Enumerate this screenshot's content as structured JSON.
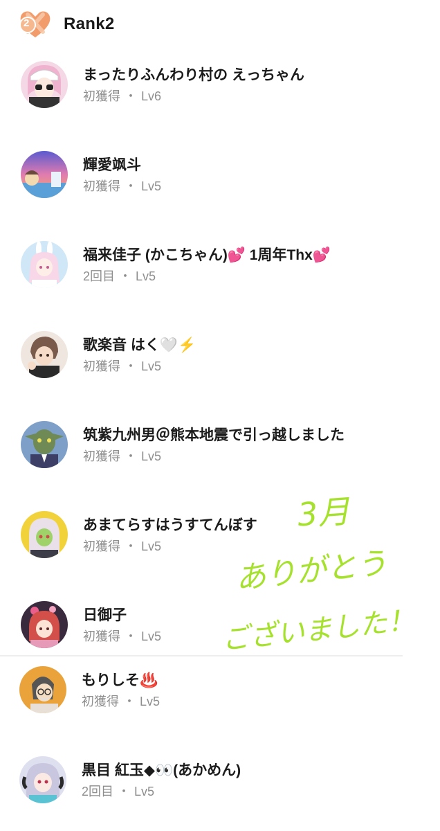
{
  "header": {
    "rank_number": "2",
    "title": "Rank2",
    "badge_color": "#f29b6b"
  },
  "rows": [
    {
      "name": "まったりふんわり村の えっちゃん",
      "label": "初獲得",
      "level": "Lv6",
      "avatar_bg": "#f4d8e6",
      "avatar_fg": "#f0b3cf"
    },
    {
      "name": "輝愛飒斗",
      "label": "初獲得",
      "level": "Lv5",
      "avatar_bg": "#7c6fd1",
      "avatar_fg": "#f2a05f"
    },
    {
      "name": "福来佳子 (かこちゃん)💕 1周年Thx💕",
      "label": "2回目",
      "level": "Lv5",
      "avatar_bg": "#cfe7f7",
      "avatar_fg": "#f7d7e8"
    },
    {
      "name": "歌楽音 はく🤍⚡️",
      "label": "初獲得",
      "level": "Lv5",
      "avatar_bg": "#efe6df",
      "avatar_fg": "#7a5a4a"
    },
    {
      "name": "筑紫九州男＠熊本地震で引っ越しました",
      "label": "初獲得",
      "level": "Lv5",
      "avatar_bg": "#7d9fc8",
      "avatar_fg": "#6f8a55"
    },
    {
      "name": "あまてらすはうすてんぼす",
      "label": "初獲得",
      "level": "Lv5",
      "avatar_bg": "#f2d23a",
      "avatar_fg": "#e9e0ea"
    },
    {
      "name": "日御子",
      "label": "初獲得",
      "level": "Lv5",
      "avatar_bg": "#3a2a3e",
      "avatar_fg": "#d3504a"
    },
    {
      "name": "もりしそ♨️",
      "label": "初獲得",
      "level": "Lv5",
      "avatar_bg": "#e9a33a",
      "avatar_fg": "#e8e0d6"
    },
    {
      "name": "黒目 紅玉◆👀(あかめん)",
      "label": "2回目",
      "level": "Lv5",
      "avatar_bg": "#dfe0ef",
      "avatar_fg": "#c9c6df"
    }
  ],
  "handwritten_note": {
    "line1": "3月",
    "line2": "ありがとう",
    "line3": "ございました！",
    "color": "#a6e12e"
  }
}
